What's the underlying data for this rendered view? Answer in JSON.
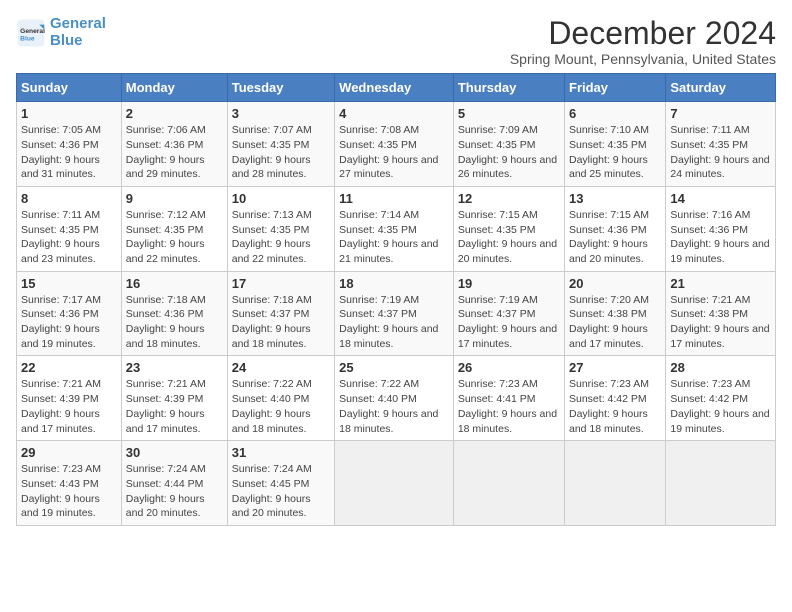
{
  "logo": {
    "line1": "General",
    "line2": "Blue"
  },
  "title": "December 2024",
  "subtitle": "Spring Mount, Pennsylvania, United States",
  "days_of_week": [
    "Sunday",
    "Monday",
    "Tuesday",
    "Wednesday",
    "Thursday",
    "Friday",
    "Saturday"
  ],
  "weeks": [
    [
      {
        "day": "1",
        "sunrise": "7:05 AM",
        "sunset": "4:36 PM",
        "daylight": "9 hours and 31 minutes."
      },
      {
        "day": "2",
        "sunrise": "7:06 AM",
        "sunset": "4:36 PM",
        "daylight": "9 hours and 29 minutes."
      },
      {
        "day": "3",
        "sunrise": "7:07 AM",
        "sunset": "4:35 PM",
        "daylight": "9 hours and 28 minutes."
      },
      {
        "day": "4",
        "sunrise": "7:08 AM",
        "sunset": "4:35 PM",
        "daylight": "9 hours and 27 minutes."
      },
      {
        "day": "5",
        "sunrise": "7:09 AM",
        "sunset": "4:35 PM",
        "daylight": "9 hours and 26 minutes."
      },
      {
        "day": "6",
        "sunrise": "7:10 AM",
        "sunset": "4:35 PM",
        "daylight": "9 hours and 25 minutes."
      },
      {
        "day": "7",
        "sunrise": "7:11 AM",
        "sunset": "4:35 PM",
        "daylight": "9 hours and 24 minutes."
      }
    ],
    [
      {
        "day": "8",
        "sunrise": "7:11 AM",
        "sunset": "4:35 PM",
        "daylight": "9 hours and 23 minutes."
      },
      {
        "day": "9",
        "sunrise": "7:12 AM",
        "sunset": "4:35 PM",
        "daylight": "9 hours and 22 minutes."
      },
      {
        "day": "10",
        "sunrise": "7:13 AM",
        "sunset": "4:35 PM",
        "daylight": "9 hours and 22 minutes."
      },
      {
        "day": "11",
        "sunrise": "7:14 AM",
        "sunset": "4:35 PM",
        "daylight": "9 hours and 21 minutes."
      },
      {
        "day": "12",
        "sunrise": "7:15 AM",
        "sunset": "4:35 PM",
        "daylight": "9 hours and 20 minutes."
      },
      {
        "day": "13",
        "sunrise": "7:15 AM",
        "sunset": "4:36 PM",
        "daylight": "9 hours and 20 minutes."
      },
      {
        "day": "14",
        "sunrise": "7:16 AM",
        "sunset": "4:36 PM",
        "daylight": "9 hours and 19 minutes."
      }
    ],
    [
      {
        "day": "15",
        "sunrise": "7:17 AM",
        "sunset": "4:36 PM",
        "daylight": "9 hours and 19 minutes."
      },
      {
        "day": "16",
        "sunrise": "7:18 AM",
        "sunset": "4:36 PM",
        "daylight": "9 hours and 18 minutes."
      },
      {
        "day": "17",
        "sunrise": "7:18 AM",
        "sunset": "4:37 PM",
        "daylight": "9 hours and 18 minutes."
      },
      {
        "day": "18",
        "sunrise": "7:19 AM",
        "sunset": "4:37 PM",
        "daylight": "9 hours and 18 minutes."
      },
      {
        "day": "19",
        "sunrise": "7:19 AM",
        "sunset": "4:37 PM",
        "daylight": "9 hours and 17 minutes."
      },
      {
        "day": "20",
        "sunrise": "7:20 AM",
        "sunset": "4:38 PM",
        "daylight": "9 hours and 17 minutes."
      },
      {
        "day": "21",
        "sunrise": "7:21 AM",
        "sunset": "4:38 PM",
        "daylight": "9 hours and 17 minutes."
      }
    ],
    [
      {
        "day": "22",
        "sunrise": "7:21 AM",
        "sunset": "4:39 PM",
        "daylight": "9 hours and 17 minutes."
      },
      {
        "day": "23",
        "sunrise": "7:21 AM",
        "sunset": "4:39 PM",
        "daylight": "9 hours and 17 minutes."
      },
      {
        "day": "24",
        "sunrise": "7:22 AM",
        "sunset": "4:40 PM",
        "daylight": "9 hours and 18 minutes."
      },
      {
        "day": "25",
        "sunrise": "7:22 AM",
        "sunset": "4:40 PM",
        "daylight": "9 hours and 18 minutes."
      },
      {
        "day": "26",
        "sunrise": "7:23 AM",
        "sunset": "4:41 PM",
        "daylight": "9 hours and 18 minutes."
      },
      {
        "day": "27",
        "sunrise": "7:23 AM",
        "sunset": "4:42 PM",
        "daylight": "9 hours and 18 minutes."
      },
      {
        "day": "28",
        "sunrise": "7:23 AM",
        "sunset": "4:42 PM",
        "daylight": "9 hours and 19 minutes."
      }
    ],
    [
      {
        "day": "29",
        "sunrise": "7:23 AM",
        "sunset": "4:43 PM",
        "daylight": "9 hours and 19 minutes."
      },
      {
        "day": "30",
        "sunrise": "7:24 AM",
        "sunset": "4:44 PM",
        "daylight": "9 hours and 20 minutes."
      },
      {
        "day": "31",
        "sunrise": "7:24 AM",
        "sunset": "4:45 PM",
        "daylight": "9 hours and 20 minutes."
      },
      null,
      null,
      null,
      null
    ]
  ]
}
